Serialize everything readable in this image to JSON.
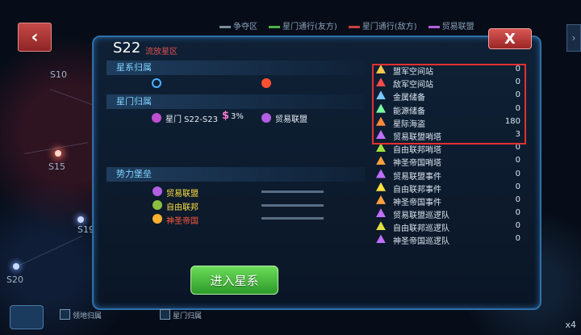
{
  "top_legend": [
    {
      "label": "争夺区",
      "color": "#7a8ca0"
    },
    {
      "label": "星门通行(友方)",
      "color": "#4fb14a"
    },
    {
      "label": "星门通行(敌方)",
      "color": "#c84040"
    },
    {
      "label": "贸易联盟",
      "color": "#b060e0"
    }
  ],
  "map_labels": {
    "s10": "S10",
    "s15": "S15",
    "s19": "S19",
    "s20": "S20"
  },
  "panel": {
    "title": "S22",
    "subtitle": "流放星区",
    "section_system": "星系归属",
    "section_gate": "星门归属",
    "gate_name": "星门 S22-S23",
    "gate_tax": "3%",
    "gate_owner": "贸易联盟",
    "section_fortress": "势力堡垒",
    "fortresses": [
      {
        "name": "贸易联盟",
        "color": "#ffe040"
      },
      {
        "name": "自由联邦",
        "color": "#ffe040"
      },
      {
        "name": "神圣帝国",
        "color": "#ff5a3c"
      }
    ],
    "enter_label": "进入星系",
    "close_label": "X"
  },
  "stats": [
    {
      "label": "盟军空间站",
      "value": "0",
      "icon": "station-ally-icon",
      "color": "#ffc84a"
    },
    {
      "label": "敌军空间站",
      "value": "0",
      "icon": "station-enemy-icon",
      "color": "#ff4a4a"
    },
    {
      "label": "金属储备",
      "value": "0",
      "icon": "metal-icon",
      "color": "#7ac8ff"
    },
    {
      "label": "能源储备",
      "value": "0",
      "icon": "energy-icon",
      "color": "#7affa0"
    },
    {
      "label": "星际海盗",
      "value": "180",
      "icon": "pirate-skull-icon",
      "color": "#ff8a3a"
    },
    {
      "label": "贸易联盟哨塔",
      "value": "3",
      "icon": "trade-tower-icon",
      "color": "#c070ff"
    },
    {
      "label": "自由联邦哨塔",
      "value": "0",
      "icon": "free-tower-icon",
      "color": "#a0e040"
    },
    {
      "label": "神圣帝国哨塔",
      "value": "0",
      "icon": "holy-tower-icon",
      "color": "#ffa040"
    },
    {
      "label": "贸易联盟事件",
      "value": "0",
      "icon": "trade-event-icon",
      "color": "#c070ff"
    },
    {
      "label": "自由联邦事件",
      "value": "0",
      "icon": "free-event-icon",
      "color": "#ffe040"
    },
    {
      "label": "神圣帝国事件",
      "value": "0",
      "icon": "holy-event-icon",
      "color": "#ffa040"
    },
    {
      "label": "贸易联盟巡逻队",
      "value": "0",
      "icon": "trade-patrol-icon",
      "color": "#c070ff"
    },
    {
      "label": "自由联邦巡逻队",
      "value": "0",
      "icon": "free-patrol-icon",
      "color": "#e0e040"
    },
    {
      "label": "神圣帝国巡逻队",
      "value": "0",
      "icon": "holy-patrol-icon",
      "color": "#c070ff"
    }
  ],
  "bottom": {
    "territory": "领地归属",
    "gate": "星门归属",
    "zoom": "x4"
  }
}
